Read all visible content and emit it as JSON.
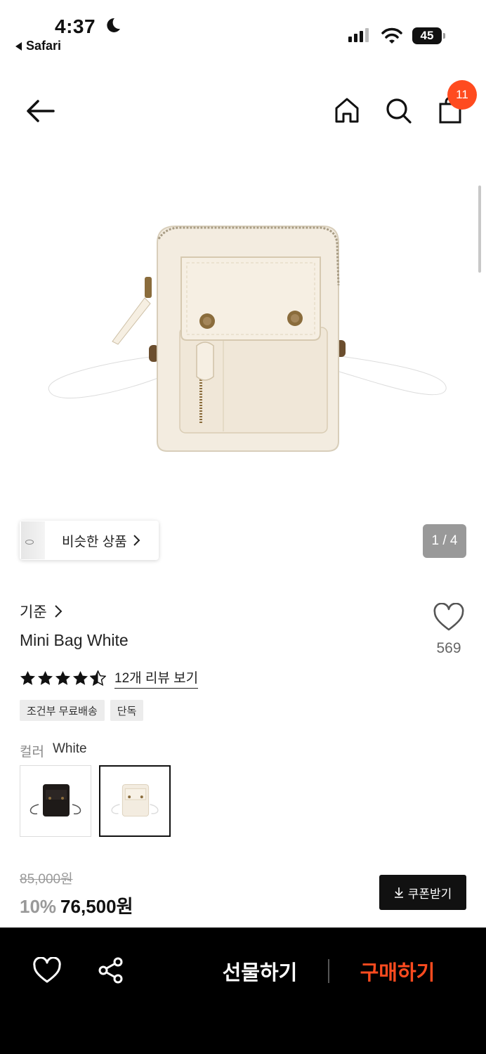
{
  "status_bar": {
    "time": "4:37",
    "back_app": "Safari",
    "battery": "45"
  },
  "nav": {
    "cart_count": "11"
  },
  "gallery": {
    "similar_label": "비슷한 상품",
    "page_counter": "1 / 4"
  },
  "product": {
    "brand": "기준",
    "name": "Mini Bag White",
    "rating": 4.5,
    "review_link": "12개 리뷰 보기",
    "like_count": "569",
    "tags": [
      "조건부 무료배송",
      "단독"
    ],
    "color_label": "컬러",
    "color_value": "White",
    "original_price": "85,000원",
    "discount": "10%",
    "sale_price": "76,500원",
    "coupon_label": "쿠폰받기"
  },
  "bottom_bar": {
    "gift_label": "선물하기",
    "buy_label": "구매하기"
  },
  "colors": {
    "accent": "#ff4b1f",
    "bag_cream": "#f3ece0"
  }
}
